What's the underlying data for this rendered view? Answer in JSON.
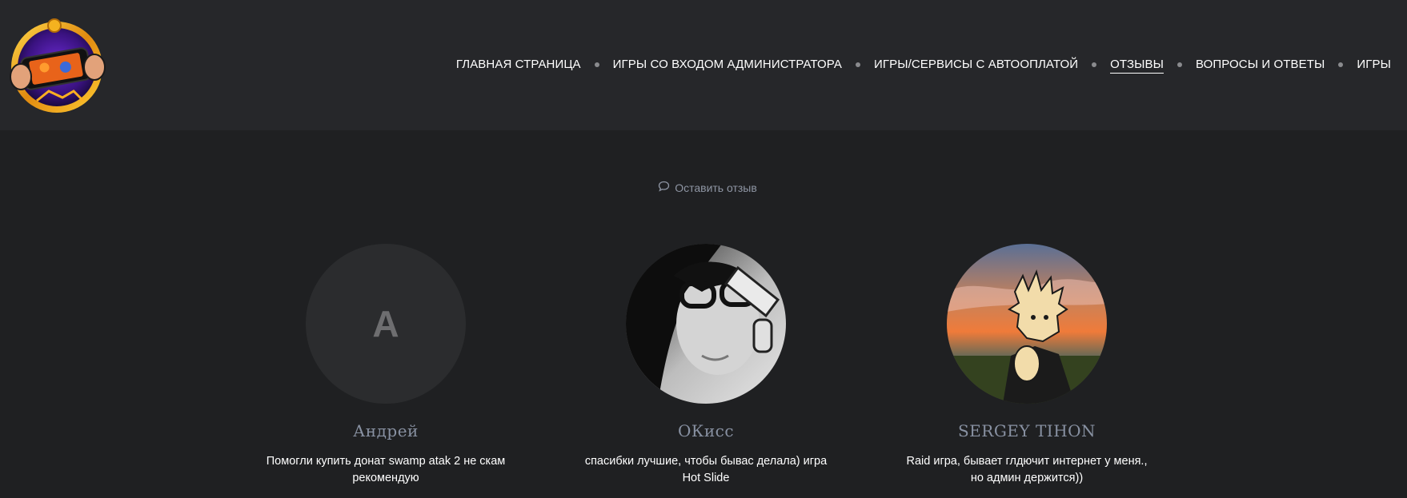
{
  "header": {
    "logo_icon": "gamepad-logo-icon",
    "nav": [
      {
        "label": "ГЛАВНАЯ СТРАНИЦА",
        "active": false
      },
      {
        "label": "ИГРЫ СО ВХОДОМ АДМИНИСТРАТОРА",
        "active": false
      },
      {
        "label": "ИГРЫ/СЕРВИСЫ С АВТООПЛАТОЙ",
        "active": false
      },
      {
        "label": "ОТЗЫВЫ",
        "active": true
      },
      {
        "label": "ВОПРОСЫ И ОТВЕТЫ",
        "active": false
      },
      {
        "label": "ИГРЫ",
        "active": false
      }
    ]
  },
  "main": {
    "leave_review": {
      "icon": "comment-icon",
      "label": "Оставить отзыв"
    },
    "reviews": [
      {
        "avatar_letter": "А",
        "name": "Андрей",
        "text": "Помогли купить донат swamp atak 2 не скам рекомендую"
      },
      {
        "avatar_letter": "",
        "name": "ОКисс",
        "text": "спасибки лучшие, чтобы бывас делала) игра Hot Slide"
      },
      {
        "avatar_letter": "",
        "name": "SERGEY TIHON",
        "text": "Raid игра, бывает глдючит интернет у меня., но админ держится))"
      }
    ]
  },
  "colors": {
    "header_bg": "#26272a",
    "page_bg": "#1f2022",
    "accent_muted": "#8891a2"
  }
}
